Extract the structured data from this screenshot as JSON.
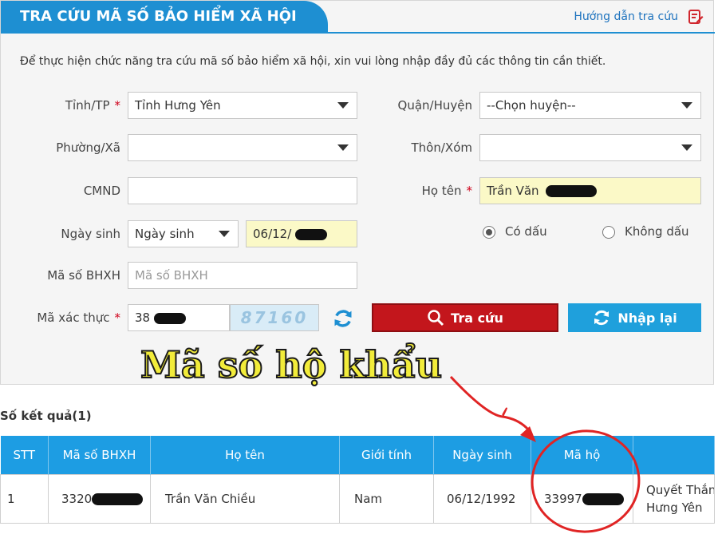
{
  "header": {
    "title": "TRA CỨU MÃ SỐ BẢO HIỂM XÃ HỘI",
    "guide_label": "Hướng dẫn tra cứu",
    "guide_icon": "edit-document-icon"
  },
  "instruction": "Để thực hiện chức năng tra cứu mã số bảo hiểm xã hội, xin vui lòng nhập đầy đủ các thông tin cần thiết.",
  "form": {
    "province": {
      "label": "Tỉnh/TP",
      "required_mark": "*",
      "value": "Tỉnh Hưng Yên"
    },
    "district": {
      "label": "Quận/Huyện",
      "value": "--Chọn huyện--"
    },
    "ward": {
      "label": "Phường/Xã",
      "value": ""
    },
    "hamlet": {
      "label": "Thôn/Xóm",
      "value": ""
    },
    "id_card": {
      "label": "CMND",
      "value": ""
    },
    "full_name": {
      "label": "Họ tên",
      "required_mark": "*",
      "value": "Trần Văn"
    },
    "birth": {
      "label": "Ngày sinh",
      "select_value": "Ngày sinh",
      "value": "06/12/"
    },
    "accent_options": {
      "with_accent": "Có dấu",
      "without_accent": "Không dấu",
      "selected": "with_accent"
    },
    "bhxh_code": {
      "label": "Mã số BHXH",
      "placeholder": "Mã số BHXH",
      "value": ""
    },
    "captcha": {
      "label": "Mã xác thực",
      "required_mark": "*",
      "value": "38",
      "image_text": "87160"
    }
  },
  "buttons": {
    "search": "Tra cứu",
    "reset": "Nhập lại"
  },
  "annotation": {
    "text": "Mã số hộ khẩu",
    "color": "#f2ec3a"
  },
  "results": {
    "count_label": "Số kết quả(1)",
    "columns": [
      "STT",
      "Mã số BHXH",
      "Họ tên",
      "Giới tính",
      "Ngày sinh",
      "Mã hộ",
      ""
    ],
    "rows": [
      {
        "stt": "1",
        "bhxh": "3320",
        "name": "Trần Văn Chiều",
        "gender": "Nam",
        "dob": "06/12/1992",
        "household": "33997",
        "address_line1": "Quyết Thắn",
        "address_line2": "Hưng Yên"
      }
    ]
  },
  "colors": {
    "accent": "#1e8fd2",
    "search_button": "#c3161c",
    "reset_button": "#1fa0dc",
    "table_header": "#1d9de3",
    "highlight_field": "#fbf9c7",
    "annotation_red": "#e02424"
  }
}
